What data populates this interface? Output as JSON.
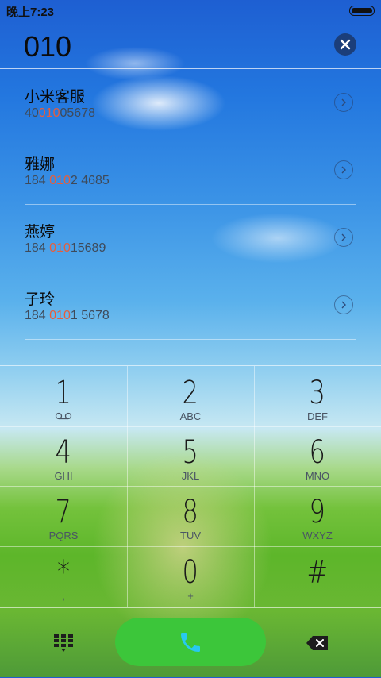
{
  "status_bar": {
    "time": "晚上7:23"
  },
  "dialer": {
    "input": "010"
  },
  "results": [
    {
      "name": "小米客服",
      "pre": "40",
      "match": "010",
      "post": "05678"
    },
    {
      "name": "雅娜",
      "pre": "184 ",
      "match": "010",
      "post": "2 4685"
    },
    {
      "name": "燕婷",
      "pre": "184 ",
      "match": "010",
      "post": "15689"
    },
    {
      "name": "子玲",
      "pre": "184 ",
      "match": "010",
      "post": "1 5678"
    }
  ],
  "keypad": {
    "k1": {
      "digit": "1",
      "letters": ""
    },
    "k2": {
      "digit": "2",
      "letters": "ABC"
    },
    "k3": {
      "digit": "3",
      "letters": "DEF"
    },
    "k4": {
      "digit": "4",
      "letters": "GHI"
    },
    "k5": {
      "digit": "5",
      "letters": "JKL"
    },
    "k6": {
      "digit": "6",
      "letters": "MNO"
    },
    "k7": {
      "digit": "7",
      "letters": "PQRS"
    },
    "k8": {
      "digit": "8",
      "letters": "TUV"
    },
    "k9": {
      "digit": "9",
      "letters": "WXYZ"
    },
    "star": {
      "digit": "*",
      "letters": ","
    },
    "k0": {
      "digit": "0",
      "letters": "+"
    },
    "hash": {
      "digit": "#",
      "letters": ""
    }
  },
  "icons": {
    "voicemail": "voicemail-icon",
    "clear": "close-icon",
    "chevron": "chevron-right-icon",
    "dialpad": "dialpad-icon",
    "call": "phone-icon",
    "backspace": "backspace-icon"
  },
  "colors": {
    "highlight": "#e85d3a",
    "call_button": "#3cc63a"
  }
}
